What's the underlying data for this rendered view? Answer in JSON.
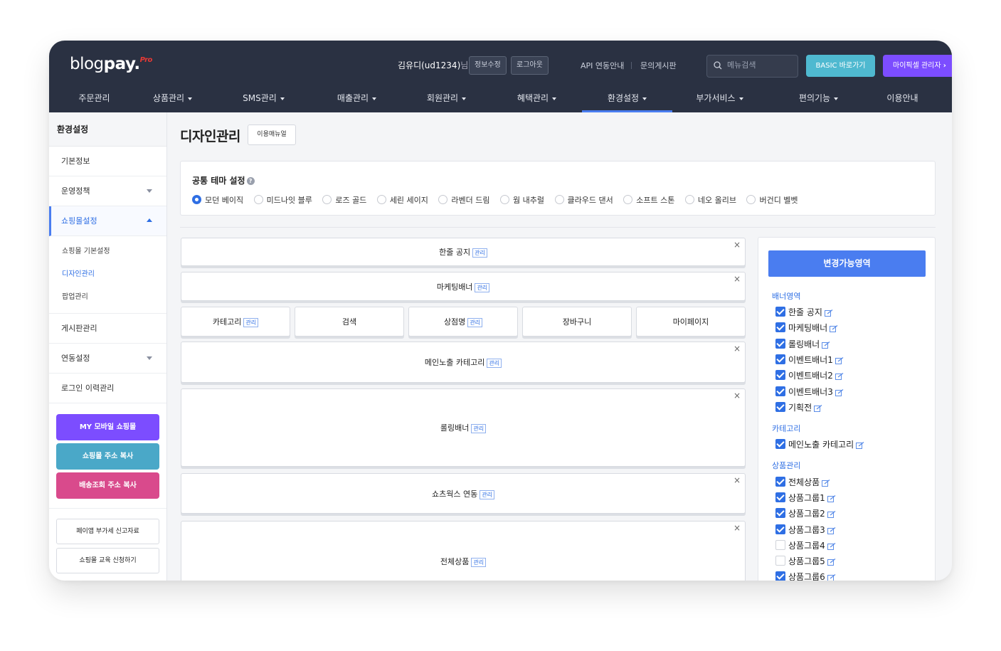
{
  "header": {
    "logo_light": "blog",
    "logo_bold": "pay",
    "logo_dot": ".",
    "logo_pro": "Pro",
    "user_name": "김유디(ud1234)",
    "user_suffix": "님",
    "btn_edit_info": "정보수정",
    "btn_logout": "로그아웃",
    "link_api": "API 연동안내",
    "link_board": "문의게시판",
    "search_placeholder": "메뉴검색",
    "btn_basic": "BASIC 바로가기",
    "btn_mypick": "마이픽셀 관리자"
  },
  "nav": [
    {
      "label": "주문관리",
      "dropdown": false
    },
    {
      "label": "상품관리",
      "dropdown": true
    },
    {
      "label": "SMS관리",
      "dropdown": true
    },
    {
      "label": "매출관리",
      "dropdown": true
    },
    {
      "label": "회원관리",
      "dropdown": true
    },
    {
      "label": "혜택관리",
      "dropdown": true
    },
    {
      "label": "환경설정",
      "dropdown": true,
      "active": true
    },
    {
      "label": "부가서비스",
      "dropdown": true
    },
    {
      "label": "편의기능",
      "dropdown": true
    },
    {
      "label": "이용안내",
      "dropdown": false
    }
  ],
  "sidebar": {
    "title": "환경설정",
    "items": [
      "기본정보",
      "운영정책",
      "쇼핑몰설정",
      "게시판관리",
      "연동설정",
      "로그인 이력관리"
    ],
    "sub_items": [
      "쇼핑몰 기본설정",
      "디자인관리",
      "팝업관리"
    ],
    "btn_mobile": "MY 모바일 쇼핑몰",
    "btn_copy_addr": "쇼핑몰 주소 복사",
    "btn_copy_delivery": "배송조회 주소 복사",
    "btn_vat": "페이앱 부가세 신고자료",
    "btn_edu": "쇼핑몰 교육 신청하기"
  },
  "colors": {
    "header_bg": "#2a3142",
    "accent": "#4a7df0",
    "mobile_btn": "#7c4dff",
    "copy_btn": "#4aa8c8",
    "delivery_btn": "#d94a8c"
  },
  "main": {
    "title": "디자인관리",
    "manual_btn": "이용매뉴얼",
    "theme_title": "공통 테마 설정",
    "help": "?",
    "themes": [
      "모던 베이직",
      "미드나잇 블루",
      "로즈 골드",
      "세린 세이지",
      "라벤더 드림",
      "웜 내추럴",
      "클라우드 댄서",
      "소프트 스톤",
      "네오 올리브",
      "버건디 벨벳"
    ],
    "selected_theme": "모던 베이직",
    "manage_tag": "관리",
    "close": "×",
    "blocks": {
      "notice": "한줄 공지",
      "marketing": "마케팅배너",
      "category": "카테고리",
      "search": "검색",
      "store_name": "상점명",
      "cart": "장바구니",
      "mypage": "마이페이지",
      "main_category": "메인노출 카테고리",
      "rolling": "롤링배너",
      "shorts": "쇼츠웍스 연동",
      "all_products": "전체상품"
    }
  },
  "panel": {
    "title": "변경가능영역",
    "groups": [
      {
        "name": "배너영역",
        "items": [
          {
            "label": "한줄 공지",
            "checked": true
          },
          {
            "label": "마케팅배너",
            "checked": true
          },
          {
            "label": "롤링배너",
            "checked": true
          },
          {
            "label": "이벤트배너1",
            "checked": true
          },
          {
            "label": "이벤트배너2",
            "checked": true
          },
          {
            "label": "이벤트배너3",
            "checked": true
          },
          {
            "label": "기획전",
            "checked": true
          }
        ]
      },
      {
        "name": "카테고리",
        "items": [
          {
            "label": "메인노출 카테고리",
            "checked": true
          }
        ]
      },
      {
        "name": "상품관리",
        "items": [
          {
            "label": "전체상품",
            "checked": true
          },
          {
            "label": "상품그룹1",
            "checked": true
          },
          {
            "label": "상품그룹2",
            "checked": true
          },
          {
            "label": "상품그룹3",
            "checked": true
          },
          {
            "label": "상품그룹4",
            "checked": false
          },
          {
            "label": "상품그룹5",
            "checked": false
          },
          {
            "label": "상품그룹6",
            "checked": true
          }
        ]
      }
    ]
  }
}
